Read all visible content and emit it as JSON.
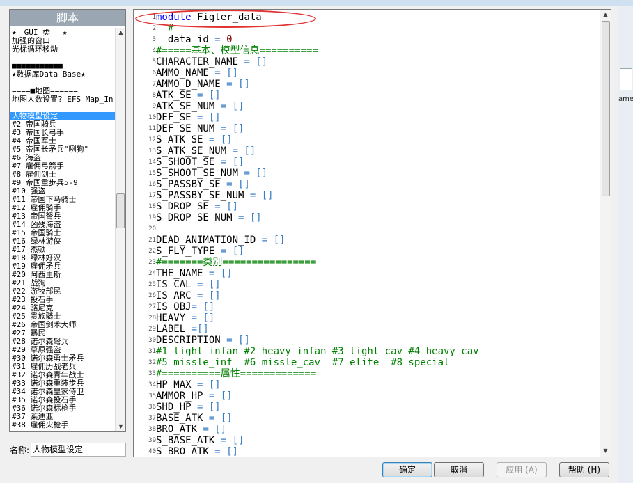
{
  "left_panel": {
    "header": "脚本",
    "items": [
      "★　GUI 类　 ★",
      "加强的窗口",
      "光标循环移动",
      "",
      "■■■■■■■■■■■",
      "★数据库Data Base★",
      "",
      "====■地图======",
      "地图人数设置? EFS Map_In",
      "",
      "人物模型设定",
      "#2  帝国骑兵",
      "#3  帝国长弓手",
      "#4  帝国军士",
      "#5  帝国长矛兵\"咧狗\"",
      "#6  海盗",
      "#7  雇佣弓箭手",
      "#8  雇佣剑士",
      "#9  帝国重步兵5-9",
      "#10 强盗",
      "#11 帝国下马骑士",
      "#12 雇佣骑手",
      "#13 帝国弩兵",
      "#14 凶残海盗",
      "#15 帝国骑士",
      "#16 绿林游侠",
      "#17 杰顿",
      "#18 绿林好汉",
      "#19 雇佣矛兵",
      "#20 阿西里斯",
      "#21 战狗",
      "#22 游牧部民",
      "#23 投石手",
      "#24 骆尼克",
      "#25 贵族骑士",
      "#26 帝国剑术大师",
      "#27 暴民",
      "#28 诺尔森弩兵",
      "#29 草原强盗",
      "#30 诺尔森勇士矛兵",
      "#31 雇佣历战老兵",
      "#32 诺尔森青年战士",
      "#33 诺尔森重装步兵",
      "#34 诺尔森皇家侍卫",
      "#35 诺尔森投石手",
      "#36 诺尔森标枪手",
      "#37 莱迪亚",
      "#38 雇佣火枪手"
    ],
    "selected_index": 10
  },
  "name_field": {
    "label": "名称:",
    "value": "人物模型设定"
  },
  "editor": {
    "lines": [
      [
        {
          "t": "module",
          "c": "kw"
        },
        {
          "t": " Figter_data",
          "c": ""
        }
      ],
      [
        {
          "t": "  #",
          "c": "cmt"
        }
      ],
      [
        {
          "t": "  data_id ",
          "c": ""
        },
        {
          "t": "=",
          "c": "op"
        },
        {
          "t": " 0",
          "c": "num"
        }
      ],
      [
        {
          "t": "#=====基本、模型信息==========",
          "c": "cmt"
        }
      ],
      [
        {
          "t": "CHARACTER_NAME ",
          "c": ""
        },
        {
          "t": "= []",
          "c": "op"
        }
      ],
      [
        {
          "t": "AMMO_NAME ",
          "c": ""
        },
        {
          "t": "= []",
          "c": "op"
        }
      ],
      [
        {
          "t": "AMMO_D_NAME ",
          "c": ""
        },
        {
          "t": "= []",
          "c": "op"
        }
      ],
      [
        {
          "t": "ATK_SE ",
          "c": ""
        },
        {
          "t": "= []",
          "c": "op"
        }
      ],
      [
        {
          "t": "ATK_SE_NUM ",
          "c": ""
        },
        {
          "t": "= []",
          "c": "op"
        }
      ],
      [
        {
          "t": "DEF_SE ",
          "c": ""
        },
        {
          "t": "= []",
          "c": "op"
        }
      ],
      [
        {
          "t": "DEF_SE_NUM ",
          "c": ""
        },
        {
          "t": "= []",
          "c": "op"
        }
      ],
      [
        {
          "t": "S_ATK_SE ",
          "c": ""
        },
        {
          "t": "= []",
          "c": "op"
        }
      ],
      [
        {
          "t": "S_ATK_SE_NUM ",
          "c": ""
        },
        {
          "t": "= []",
          "c": "op"
        }
      ],
      [
        {
          "t": "S_SHOOT_SE ",
          "c": ""
        },
        {
          "t": "= []",
          "c": "op"
        }
      ],
      [
        {
          "t": "S_SHOOT_SE_NUM ",
          "c": ""
        },
        {
          "t": "= []",
          "c": "op"
        }
      ],
      [
        {
          "t": "S_PASSBY_SE ",
          "c": ""
        },
        {
          "t": "= []",
          "c": "op"
        }
      ],
      [
        {
          "t": "S_PASSBY_SE_NUM ",
          "c": ""
        },
        {
          "t": "= []",
          "c": "op"
        }
      ],
      [
        {
          "t": "S_DROP_SE ",
          "c": ""
        },
        {
          "t": "= []",
          "c": "op"
        }
      ],
      [
        {
          "t": "S_DROP_SE_NUM ",
          "c": ""
        },
        {
          "t": "= []",
          "c": "op"
        }
      ],
      [],
      [
        {
          "t": "DEAD_ANIMATION_ID ",
          "c": ""
        },
        {
          "t": "= []",
          "c": "op"
        }
      ],
      [
        {
          "t": "S_FLY_TYPE ",
          "c": ""
        },
        {
          "t": "= []",
          "c": "op"
        }
      ],
      [
        {
          "t": "#=======类别================",
          "c": "cmt"
        }
      ],
      [
        {
          "t": "THE_NAME ",
          "c": ""
        },
        {
          "t": "= []",
          "c": "op"
        }
      ],
      [
        {
          "t": "IS_CAL ",
          "c": ""
        },
        {
          "t": "= []",
          "c": "op"
        }
      ],
      [
        {
          "t": "IS_ARC ",
          "c": ""
        },
        {
          "t": "= []",
          "c": "op"
        }
      ],
      [
        {
          "t": "IS_OBJ",
          "c": ""
        },
        {
          "t": "= []",
          "c": "op"
        }
      ],
      [
        {
          "t": "HEAVY ",
          "c": ""
        },
        {
          "t": "= []",
          "c": "op"
        }
      ],
      [
        {
          "t": "LABEL ",
          "c": ""
        },
        {
          "t": "=[]",
          "c": "op"
        }
      ],
      [
        {
          "t": "DESCRIPTION ",
          "c": ""
        },
        {
          "t": "= []",
          "c": "op"
        }
      ],
      [
        {
          "t": "#1 light infan #2 heavy infan #3 light cav #4 heavy cav",
          "c": "cmt"
        }
      ],
      [
        {
          "t": "#5 missle_inf  #6 missle_cav  #7 elite  #8 special",
          "c": "cmt"
        }
      ],
      [
        {
          "t": "#==========属性=============",
          "c": "cmt"
        }
      ],
      [
        {
          "t": "HP_MAX ",
          "c": ""
        },
        {
          "t": "= []",
          "c": "op"
        }
      ],
      [
        {
          "t": "AMMOR_HP ",
          "c": ""
        },
        {
          "t": "= []",
          "c": "op"
        }
      ],
      [
        {
          "t": "SHD_HP ",
          "c": ""
        },
        {
          "t": "= []",
          "c": "op"
        }
      ],
      [
        {
          "t": "BASE_ATK ",
          "c": ""
        },
        {
          "t": "= []",
          "c": "op"
        }
      ],
      [
        {
          "t": "BRO_ATK ",
          "c": ""
        },
        {
          "t": "= []",
          "c": "op"
        }
      ],
      [
        {
          "t": "S_BASE_ATK ",
          "c": ""
        },
        {
          "t": "= []",
          "c": "op"
        }
      ],
      [
        {
          "t": "S_BRO_ATK ",
          "c": ""
        },
        {
          "t": "= []",
          "c": "op"
        }
      ]
    ]
  },
  "buttons": {
    "ok": "确定",
    "cancel": "取消",
    "apply": "应用 (A)",
    "help": "帮助 (H)"
  },
  "desktop": {
    "file_label": "ame"
  },
  "colors": {
    "keyword": "#0000ff",
    "comment": "#008000",
    "number": "#800000",
    "operator": "#3a7ec4",
    "selection": "#3399ff",
    "annotation": "#e03030"
  },
  "icons": {
    "scroll_up": "triangle-up-icon",
    "scroll_down": "triangle-down-icon",
    "file": "file-icon"
  }
}
